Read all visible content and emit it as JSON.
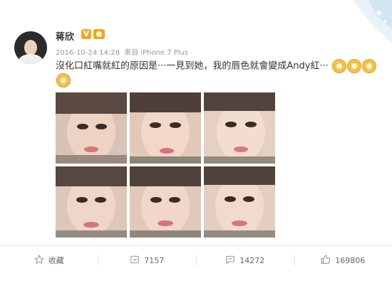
{
  "post": {
    "author": "蒋欣",
    "verified_badge": "V",
    "timestamp": "2016-10-24 14:28",
    "source": "来自 iPhone 7 Plus",
    "text": "沒化口紅嘴就紅的原因是···一見到她，我的唇色就會變成Andy紅···"
  },
  "photos": {
    "count": 6
  },
  "actions": {
    "favorite_label": "收藏",
    "repost_count": "7157",
    "comment_count": "14272",
    "like_count": "169806"
  },
  "colors": {
    "accent": "#f5a623",
    "text": "#333333",
    "muted": "#999999",
    "divider": "#e6e6e6"
  },
  "icons": {
    "favorite": "star-icon",
    "repost": "repost-icon",
    "comment": "comment-icon",
    "like": "thumbs-up-icon"
  }
}
